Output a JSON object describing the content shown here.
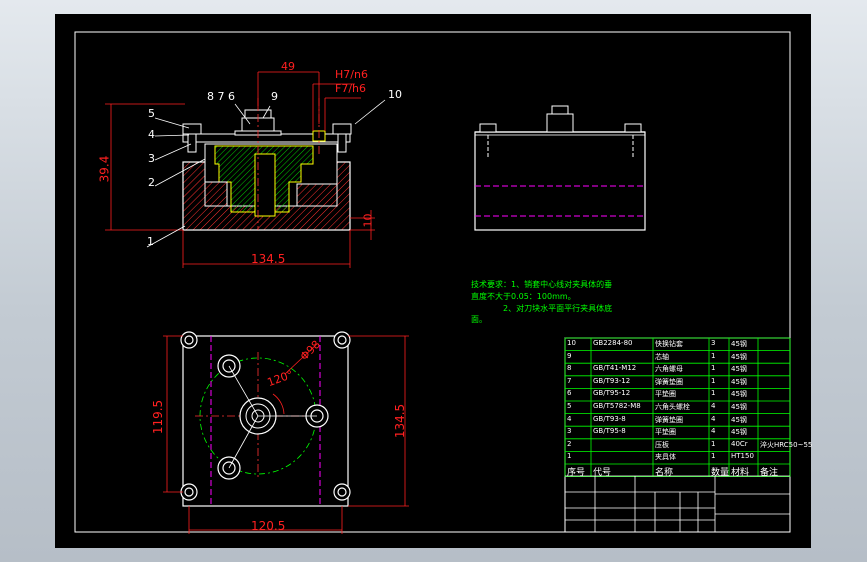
{
  "colors": {
    "background": "#000000",
    "outline": "#ffffff",
    "dimension": "#ff2020",
    "hatch": "#ff3030",
    "center_line": "#ff3333",
    "hidden_line": "#ff00ff",
    "green": "#00ff00",
    "yellow": "#ffff00",
    "notes": "#00ff00"
  },
  "front_view": {
    "callouts": [
      "1",
      "2",
      "3",
      "4",
      "5",
      "8 7 6",
      "9",
      "10"
    ],
    "dims": {
      "width": "134.5",
      "height": "39.4",
      "top": "49",
      "base": "10",
      "fit_top": "H7/n6",
      "fit_bottom": "F7/h6"
    }
  },
  "top_view": {
    "dims": {
      "width": "120.5",
      "left_height": "119.5",
      "right_height": "134.5",
      "diameter": "Φ98",
      "angle": "120°"
    }
  },
  "notes": {
    "line1": "技术要求：1、销套中心线对夹具体的垂",
    "line2": "直度不大于0.05：100mm。",
    "line3": "2、对刀块水平面平行夹具体底",
    "line4": "面。"
  },
  "bom": {
    "rows": [
      {
        "no": "10",
        "code": "GB2284-80",
        "name": "快换钻套",
        "qty": "3",
        "material": "45钢",
        "note": ""
      },
      {
        "no": "9",
        "code": "",
        "name": "芯轴",
        "qty": "1",
        "material": "45钢",
        "note": ""
      },
      {
        "no": "8",
        "code": "GB/T41-M12",
        "name": "六角螺母",
        "qty": "1",
        "material": "45钢",
        "note": ""
      },
      {
        "no": "7",
        "code": "GB/T93-12",
        "name": "弹簧垫圈",
        "qty": "1",
        "material": "45钢",
        "note": ""
      },
      {
        "no": "6",
        "code": "GB/T95-12",
        "name": "平垫圈",
        "qty": "1",
        "material": "45钢",
        "note": ""
      },
      {
        "no": "5",
        "code": "GB/T5782-M8",
        "name": "六角头螺栓",
        "qty": "4",
        "material": "45钢",
        "note": ""
      },
      {
        "no": "4",
        "code": "GB/T93-8",
        "name": "弹簧垫圈",
        "qty": "4",
        "material": "45钢",
        "note": ""
      },
      {
        "no": "3",
        "code": "GB/T95-8",
        "name": "平垫圈",
        "qty": "4",
        "material": "45钢",
        "note": ""
      },
      {
        "no": "2",
        "code": "",
        "name": "压板",
        "qty": "1",
        "material": "40Cr",
        "note": "淬火HRC50~55"
      },
      {
        "no": "1",
        "code": "",
        "name": "夹具体",
        "qty": "1",
        "material": "HT150",
        "note": ""
      }
    ],
    "header": {
      "no": "序号",
      "code": "代号",
      "name": "名称",
      "qty": "数量",
      "material": "材料",
      "note": "备注"
    }
  }
}
